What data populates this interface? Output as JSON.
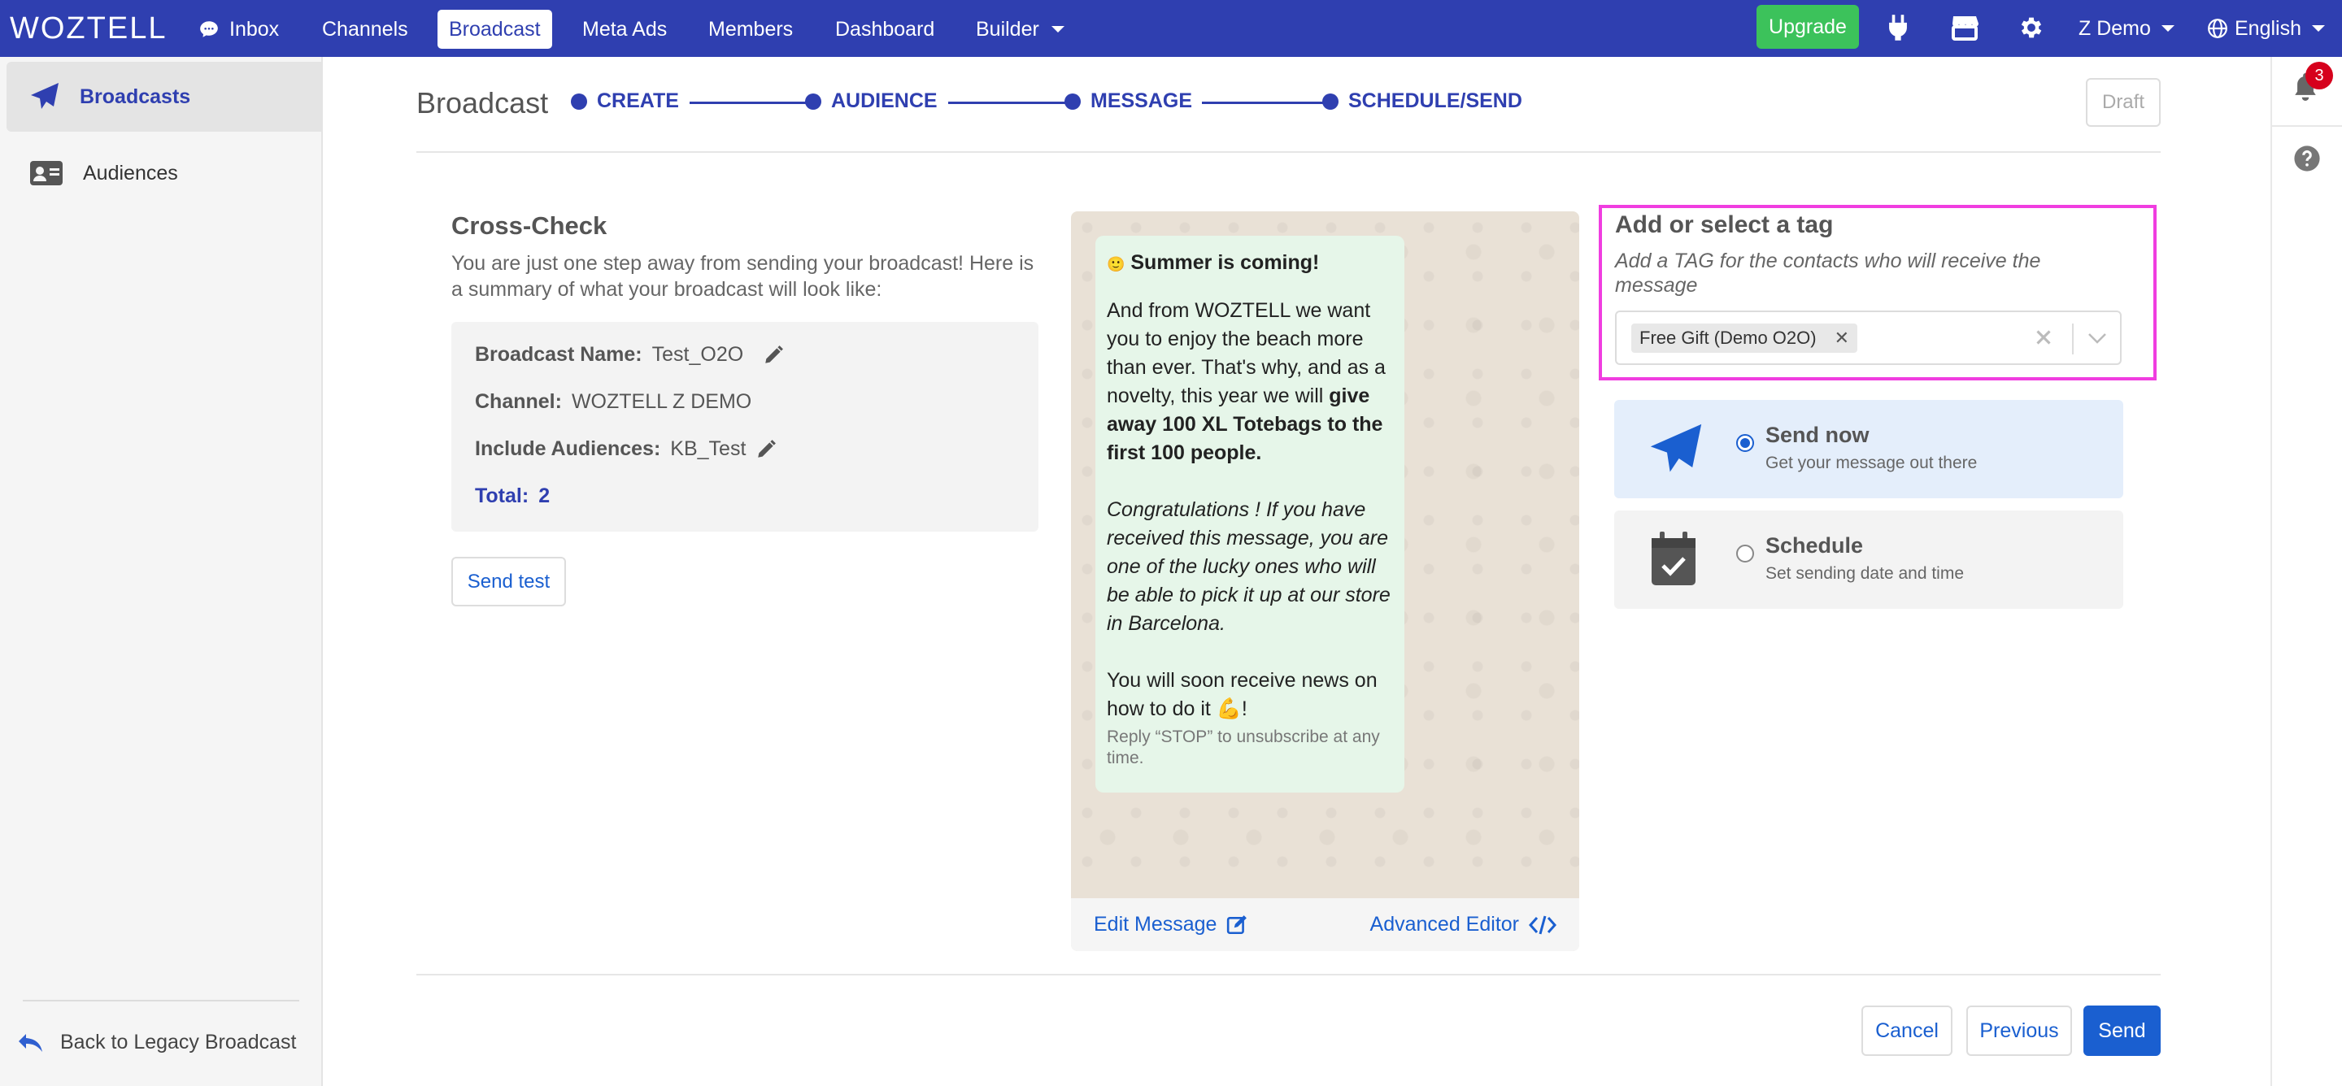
{
  "topbar": {
    "logo": "WOZTELL",
    "nav": [
      {
        "label": "Inbox"
      },
      {
        "label": "Channels"
      },
      {
        "label": "Broadcast"
      },
      {
        "label": "Meta Ads"
      },
      {
        "label": "Members"
      },
      {
        "label": "Dashboard"
      },
      {
        "label": "Builder"
      }
    ],
    "upgrade_label": "Upgrade",
    "user_label": "Z Demo",
    "language_label": "English"
  },
  "sidebar": {
    "items": [
      {
        "label": "Broadcasts",
        "icon": "paper-plane-icon"
      },
      {
        "label": "Audiences",
        "icon": "id-card-icon"
      }
    ],
    "back_label": "Back to Legacy Broadcast"
  },
  "rightrail": {
    "notification_count": "3"
  },
  "header": {
    "title": "Broadcast",
    "steps": [
      "CREATE",
      "AUDIENCE",
      "MESSAGE",
      "SCHEDULE/SEND"
    ],
    "draft_label": "Draft"
  },
  "crosscheck": {
    "title": "Cross-Check",
    "description": "You are just one step away from sending your broadcast! Here is a summary of what your broadcast will look like:",
    "rows": [
      {
        "label": "Broadcast Name:",
        "value": "Test_O2O"
      },
      {
        "label": "Channel:",
        "value": "WOZTELL Z DEMO"
      },
      {
        "label": "Include Audiences:",
        "value": "KB_Test"
      },
      {
        "label": "Total:",
        "value": "2"
      }
    ],
    "send_test_label": "Send test"
  },
  "preview": {
    "emoji_title": "🙂",
    "title": "Summer is coming!",
    "para1_plain": "And from WOZTELL we want you to enjoy the beach more than ever. That's why, and as a novelty, this year we will ",
    "para1_bold": "give away 100 XL Totebags to the first 100 people.",
    "para2": "Congratulations ! If you have received this message, you are one of the lucky ones who will be able to pick it up at our store in Barcelona.",
    "para3": "You will soon receive news on how to do it 💪!",
    "footer": "Reply “STOP” to unsubscribe at any time.",
    "edit_label": "Edit Message",
    "advanced_label": "Advanced Editor"
  },
  "tag": {
    "title": "Add or select a tag",
    "subtitle": "Add a TAG for the contacts who will receive the message",
    "selected": "Free Gift (Demo O2O)",
    "highlight_color": "#f03de0"
  },
  "send_options": [
    {
      "title": "Send now",
      "subtitle": "Get your message out there",
      "selected": true
    },
    {
      "title": "Schedule",
      "subtitle": "Set sending date and time",
      "selected": false
    }
  ],
  "actions": {
    "cancel_label": "Cancel",
    "previous_label": "Previous",
    "send_label": "Send"
  },
  "colors": {
    "brand": "#2f3fb0",
    "link": "#1a5fd0",
    "upgrade": "#3cc25b"
  }
}
